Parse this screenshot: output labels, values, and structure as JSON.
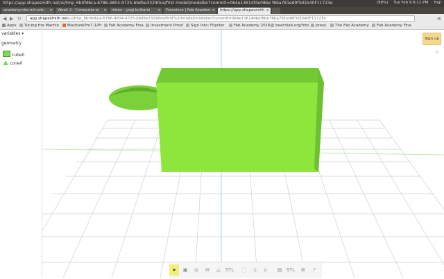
{
  "os_bar": {
    "window_title": "https://app.shapesmith.net/ui/tmp_6b0fd6ca-6786-4804-9725-bbd5e33290ce/first model/modeller?commit=064e13614f4e08be f6ba781ed9f3d1b40F11723e",
    "tray": [
      "(98%)",
      "Tue Feb 9 6:11 PM",
      "Yogi"
    ]
  },
  "tabs": [
    {
      "label": "academy.cba.mit.edu"
    },
    {
      "label": "Week 2 - Computer-ai"
    },
    {
      "label": "Inbox - yogi.kulkarni"
    },
    {
      "label": "Francisco | Fab Academ"
    },
    {
      "label": "https://app.shapesmith"
    }
  ],
  "address_bar": {
    "url_domain": "app.shapesmith.net",
    "url_rest": "/ui/tmp_6b0fd6ca-6786-4804-9725-bbd5e33290ce/first%20model/modeller?commit=064e13614f4e08be f6ba781ed9f3d1b40F11723e"
  },
  "bookmarks": [
    {
      "label": "Apps"
    },
    {
      "label": "Tuning the Machin"
    },
    {
      "label": "MacbookPro7-1/Pr"
    },
    {
      "label": "Fab Academy Fina"
    },
    {
      "label": "Investment Proof"
    },
    {
      "label": "Sign Into: Flipcter"
    },
    {
      "label": "Fab Academy 2016"
    },
    {
      "label": "beachlab.org/foto"
    },
    {
      "label": "proxy"
    },
    {
      "label": "The Fab Academy"
    },
    {
      "label": "Fab Academy Fina"
    }
  ],
  "sidebar": {
    "header": "variables",
    "section": "geometry",
    "items": [
      {
        "label": "cube0"
      },
      {
        "label": "cone0"
      }
    ]
  },
  "header": {
    "signup_label": "Sign up"
  },
  "toolbar": {
    "stl_label": "STL",
    "help_label": "?"
  },
  "colors": {
    "solid_green": "#8ee63c",
    "grid_line": "#cfcfcf"
  }
}
